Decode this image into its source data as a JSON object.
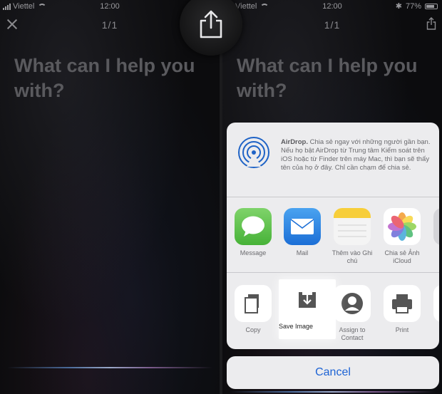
{
  "status": {
    "carrier": "Viettel",
    "time": "12:00",
    "battery": "77%"
  },
  "left": {
    "page_counter": "1/1",
    "prompt": "What can I help you with?"
  },
  "right": {
    "page_counter": "1/1",
    "prompt": "What can I help you with?",
    "airdrop": {
      "title": "AirDrop.",
      "text": " Chia sẻ ngay với những người gần bạn. Nếu họ bật AirDrop từ Trung tâm Kiểm soát trên iOS hoặc từ Finder trên máy Mac, thì bạn sẽ thấy tên của họ ở đây. Chỉ cần chạm để chia sẻ."
    },
    "apps": [
      {
        "label": "Message",
        "icon": "messages-icon"
      },
      {
        "label": "Mail",
        "icon": "mail-icon"
      },
      {
        "label": "Thêm vào Ghi chú",
        "icon": "notes-icon"
      },
      {
        "label": "Chia sẻ Ảnh iCloud",
        "icon": "photos-icon"
      },
      {
        "label": "M",
        "icon": "more-app-icon"
      }
    ],
    "actions": [
      {
        "label": "Copy",
        "icon": "copy-icon"
      },
      {
        "label": "Save Image",
        "icon": "save-image-icon"
      },
      {
        "label": "Assign to Contact",
        "icon": "contact-icon"
      },
      {
        "label": "Print",
        "icon": "print-icon"
      },
      {
        "label": "Lu",
        "icon": "more-action-icon"
      }
    ],
    "cancel_label": "Cancel"
  },
  "colors": {
    "accent": "#1d63d4",
    "sheet_bg": "#ececee",
    "prompt_text": "#5a5a5e"
  }
}
